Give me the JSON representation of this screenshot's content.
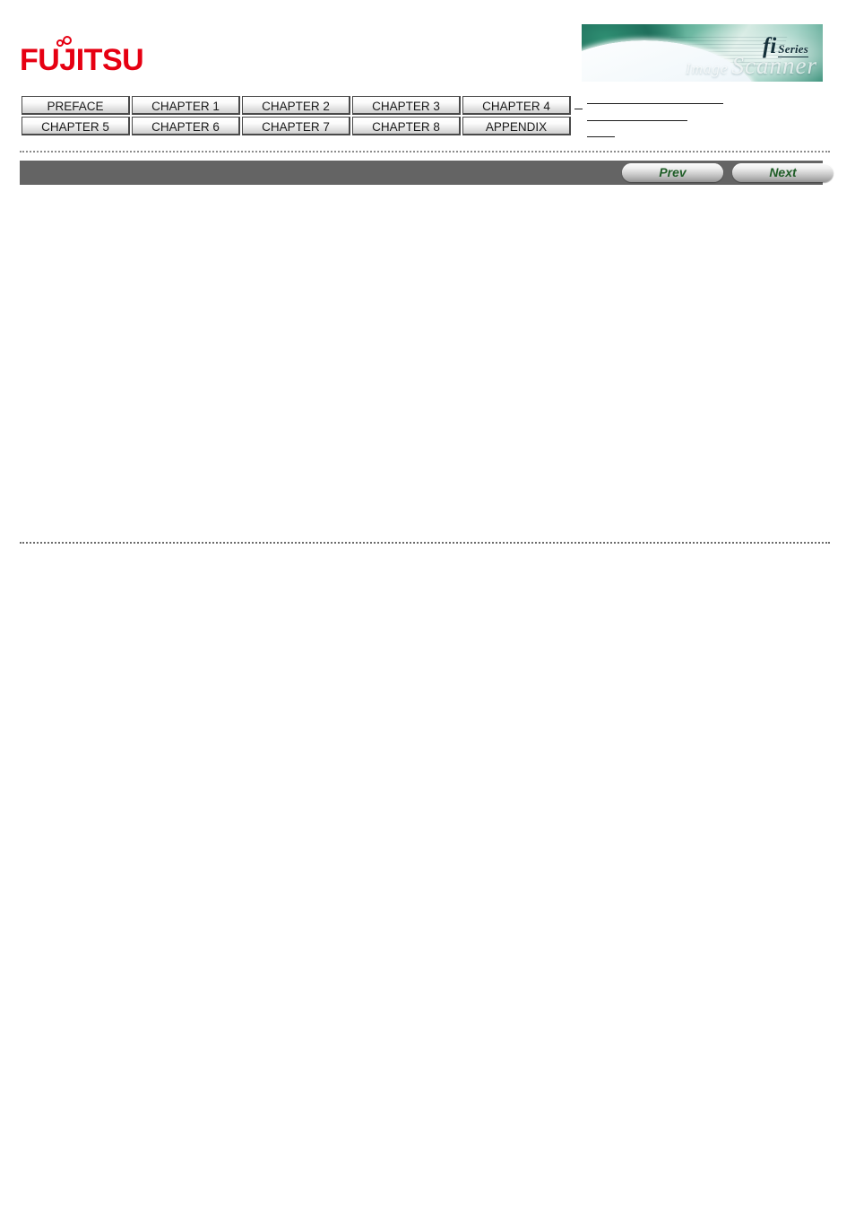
{
  "brand": {
    "logo_text": "FUJITSU",
    "logo_color": "#e60012"
  },
  "banner": {
    "product_mark": "fi",
    "product_series": "Series",
    "tagline_small": "Image",
    "tagline_script": "Scanner"
  },
  "nav_tabs": {
    "row1": [
      {
        "label": "PREFACE"
      },
      {
        "label": "CHAPTER 1"
      },
      {
        "label": "CHAPTER 2"
      },
      {
        "label": "CHAPTER 3"
      },
      {
        "label": "CHAPTER 4"
      }
    ],
    "row2": [
      {
        "label": "CHAPTER 5"
      },
      {
        "label": "CHAPTER 6"
      },
      {
        "label": "CHAPTER 7"
      },
      {
        "label": "CHAPTER 8"
      },
      {
        "label": "APPENDIX"
      }
    ]
  },
  "pager": {
    "prev_label": "Prev",
    "next_label": "Next",
    "bar_color": "#646464",
    "label_color": "#1f5d27"
  },
  "separators": {
    "dot_color": "#8c8c8c",
    "rule_color": "#1c1c1c"
  },
  "content": {
    "body_text": ""
  }
}
